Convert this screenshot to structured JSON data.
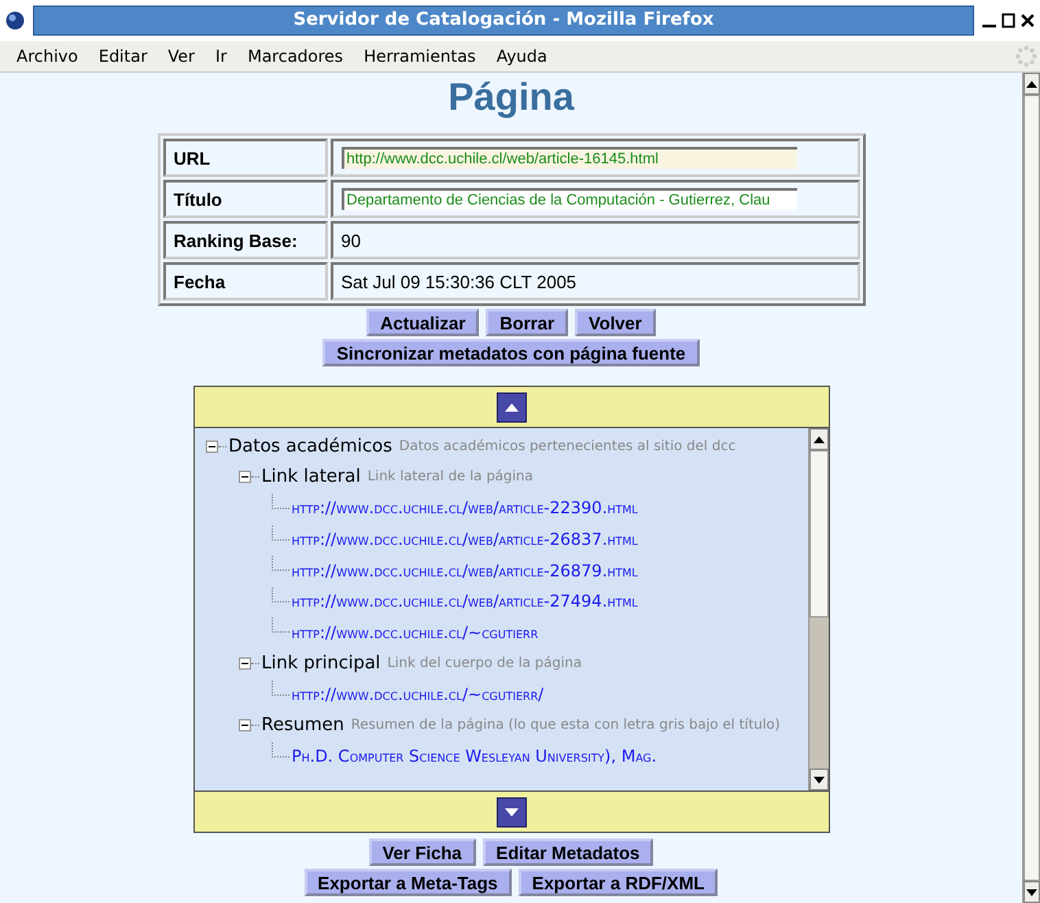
{
  "window": {
    "title": "Servidor de Catalogación - Mozilla Firefox"
  },
  "menu": [
    "Archivo",
    "Editar",
    "Ver",
    "Ir",
    "Marcadores",
    "Herramientas",
    "Ayuda"
  ],
  "heading": "Página",
  "fields": [
    {
      "label": "URL",
      "kind": "input",
      "value": "http://www.dcc.uchile.cl/web/article-16145.html"
    },
    {
      "label": "Título",
      "kind": "input",
      "value": "Departamento de Ciencias de la Computación - Gutierrez, Clau"
    },
    {
      "label": "Ranking Base:",
      "kind": "text",
      "value": "90"
    },
    {
      "label": "Fecha",
      "kind": "text",
      "value": "Sat Jul 09 15:30:36 CLT 2005"
    }
  ],
  "actions": [
    [
      "Actualizar",
      "Borrar",
      "Volver"
    ],
    [
      "Sincronizar metadatos con página fuente"
    ]
  ],
  "tree": [
    {
      "label": "Datos académicos",
      "description": "Datos académicos pertenecientes al sitio del dcc",
      "expanded": true,
      "children": [
        {
          "label": "Link lateral",
          "description": "Link lateral de la página",
          "expanded": true,
          "children": [
            {
              "link": "http://www.dcc.uchile.cl/web/article-22390.html"
            },
            {
              "link": "http://www.dcc.uchile.cl/web/article-26837.html"
            },
            {
              "link": "http://www.dcc.uchile.cl/web/article-26879.html"
            },
            {
              "link": "http://www.dcc.uchile.cl/web/article-27494.html"
            },
            {
              "link": "http://www.dcc.uchile.cl/~cgutierr"
            }
          ]
        },
        {
          "label": "Link principal",
          "description": "Link del cuerpo de la página",
          "expanded": true,
          "children": [
            {
              "link": "http://www.dcc.uchile.cl/~cgutierr/"
            }
          ]
        },
        {
          "label": "Resumen",
          "description": "Resumen de la página (lo que esta con letra gris bajo el título)",
          "expanded": true,
          "children": [
            {
              "link": "Ph.D. Computer Science Wesleyan University), Mag."
            }
          ]
        }
      ]
    }
  ],
  "bottom_actions": [
    [
      "Ver Ficha",
      "Editar Metadatos"
    ],
    [
      "Exportar a Meta-Tags",
      "Exportar a RDF/XML"
    ]
  ]
}
